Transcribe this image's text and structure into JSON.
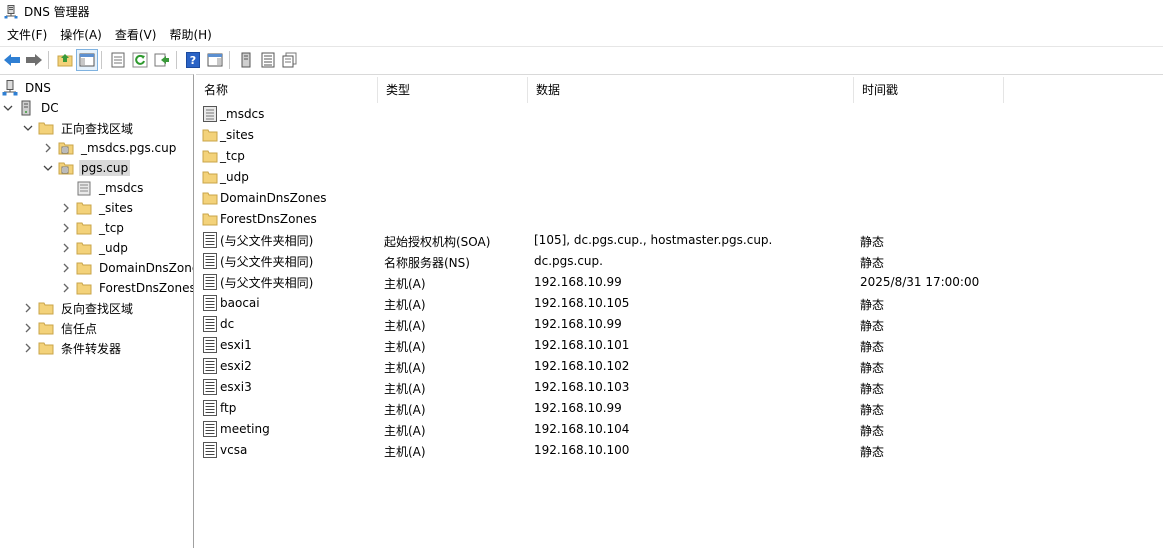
{
  "window": {
    "title": "DNS 管理器"
  },
  "menu": {
    "items": [
      "文件(F)",
      "操作(A)",
      "查看(V)",
      "帮助(H)"
    ]
  },
  "tree": {
    "root": "DNS",
    "server": "DC",
    "forward_zones": "正向查找区域",
    "zone_msdcs": "_msdcs.pgs.cup",
    "zone_pgs": "pgs.cup",
    "sub_msdcs": "_msdcs",
    "sub_sites": "_sites",
    "sub_tcp": "_tcp",
    "sub_udp": "_udp",
    "sub_domaindns": "DomainDnsZones",
    "sub_forestdns": "ForestDnsZones",
    "reverse_zones": "反向查找区域",
    "trust_points": "信任点",
    "conditional_forwarders": "条件转发器"
  },
  "columns": {
    "name": "名称",
    "type": "类型",
    "data": "数据",
    "timestamp": "时间戳"
  },
  "records": [
    {
      "icon": "delegated-folder-icon",
      "name": "_msdcs",
      "type": "",
      "data": "",
      "timestamp": ""
    },
    {
      "icon": "folder-icon",
      "name": "_sites",
      "type": "",
      "data": "",
      "timestamp": ""
    },
    {
      "icon": "folder-icon",
      "name": "_tcp",
      "type": "",
      "data": "",
      "timestamp": ""
    },
    {
      "icon": "folder-icon",
      "name": "_udp",
      "type": "",
      "data": "",
      "timestamp": ""
    },
    {
      "icon": "folder-icon",
      "name": "DomainDnsZones",
      "type": "",
      "data": "",
      "timestamp": ""
    },
    {
      "icon": "folder-icon",
      "name": "ForestDnsZones",
      "type": "",
      "data": "",
      "timestamp": ""
    },
    {
      "icon": "record-icon",
      "name": "(与父文件夹相同)",
      "type": "起始授权机构(SOA)",
      "data": "[105], dc.pgs.cup., hostmaster.pgs.cup.",
      "timestamp": "静态"
    },
    {
      "icon": "record-icon",
      "name": "(与父文件夹相同)",
      "type": "名称服务器(NS)",
      "data": "dc.pgs.cup.",
      "timestamp": "静态"
    },
    {
      "icon": "record-icon",
      "name": "(与父文件夹相同)",
      "type": "主机(A)",
      "data": "192.168.10.99",
      "timestamp": "2025/8/31 17:00:00"
    },
    {
      "icon": "record-icon",
      "name": "baocai",
      "type": "主机(A)",
      "data": "192.168.10.105",
      "timestamp": "静态"
    },
    {
      "icon": "record-icon",
      "name": "dc",
      "type": "主机(A)",
      "data": "192.168.10.99",
      "timestamp": "静态"
    },
    {
      "icon": "record-icon",
      "name": "esxi1",
      "type": "主机(A)",
      "data": "192.168.10.101",
      "timestamp": "静态"
    },
    {
      "icon": "record-icon",
      "name": "esxi2",
      "type": "主机(A)",
      "data": "192.168.10.102",
      "timestamp": "静态"
    },
    {
      "icon": "record-icon",
      "name": "esxi3",
      "type": "主机(A)",
      "data": "192.168.10.103",
      "timestamp": "静态"
    },
    {
      "icon": "record-icon",
      "name": "ftp",
      "type": "主机(A)",
      "data": "192.168.10.99",
      "timestamp": "静态"
    },
    {
      "icon": "record-icon",
      "name": "meeting",
      "type": "主机(A)",
      "data": "192.168.10.104",
      "timestamp": "静态"
    },
    {
      "icon": "record-icon",
      "name": "vcsa",
      "type": "主机(A)",
      "data": "192.168.10.100",
      "timestamp": "静态"
    }
  ],
  "colors": {
    "folder": "#f3d27a",
    "folder_border": "#c9a448",
    "selection": "#d9d9d9",
    "nav_arrow": "#2f7fd3"
  }
}
